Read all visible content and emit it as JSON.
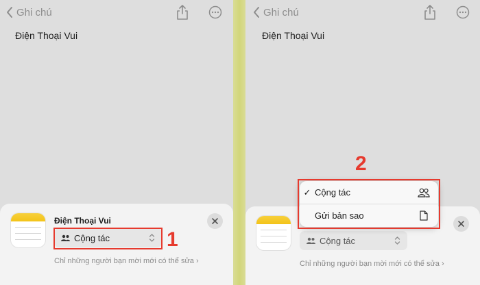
{
  "left": {
    "nav_back": "Ghi chú",
    "note_title": "Điện Thoại Vui",
    "sheet": {
      "title": "Điện Thoại Vui",
      "mode": "Cộng tác",
      "note": "Chỉ những người bạn mời mới có thể sửa"
    },
    "step": "1"
  },
  "right": {
    "nav_back": "Ghi chú",
    "note_title": "Điện Thoại Vui",
    "sheet": {
      "mode": "Cộng tác",
      "note": "Chỉ những người bạn mời mới có thể sửa"
    },
    "dropdown": {
      "items": [
        {
          "label": "Cộng tác",
          "checked": true,
          "icon": "people-icon"
        },
        {
          "label": "Gửi bản sao",
          "checked": false,
          "icon": "document-icon"
        }
      ],
      "checkmark": "✓"
    },
    "step": "2"
  },
  "colors": {
    "accent_red": "#e63a2e",
    "notes_yellow": "#f3c419",
    "divider_yellow": "#d2d67a"
  }
}
